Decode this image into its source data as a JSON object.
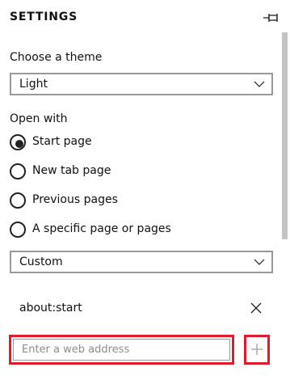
{
  "header": {
    "title": "SETTINGS",
    "pin_icon": "pin-icon"
  },
  "theme": {
    "label": "Choose a theme",
    "selected": "Light",
    "icon": "chevron-down-icon"
  },
  "open_with": {
    "label": "Open with",
    "options": [
      {
        "label": "Start page",
        "checked": true
      },
      {
        "label": "New tab page",
        "checked": false
      },
      {
        "label": "Previous pages",
        "checked": false
      },
      {
        "label": "A specific page or pages",
        "checked": false
      }
    ],
    "pages_select": "Custom"
  },
  "custom_pages": {
    "entries": [
      "about:start"
    ],
    "remove_icon": "close-icon",
    "address_placeholder": "Enter a web address",
    "add_icon": "plus-icon"
  },
  "colors": {
    "highlight": "#e21b2c",
    "scrollbar_thumb": "#c3c3c3"
  }
}
